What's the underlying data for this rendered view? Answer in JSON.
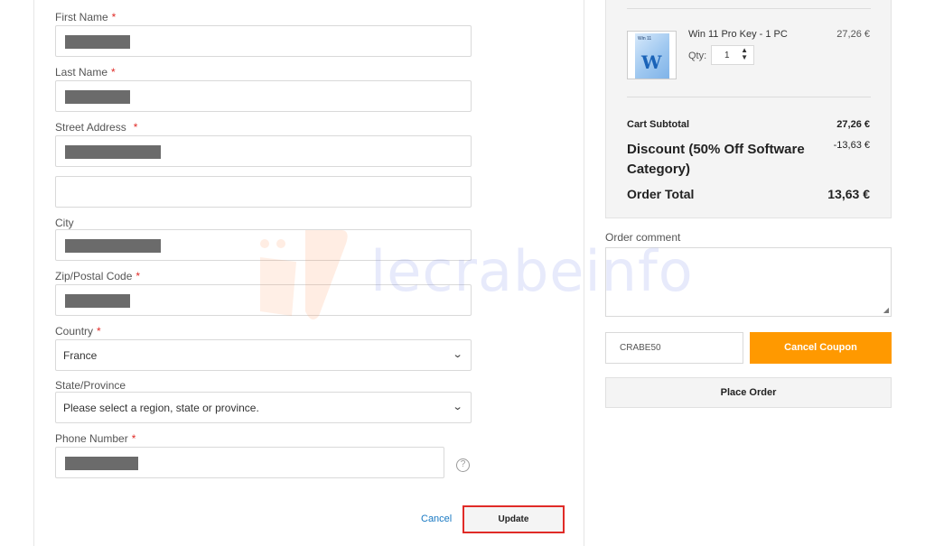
{
  "form": {
    "first_name_label": "First Name",
    "last_name_label": "Last Name",
    "street_label": "Street Address",
    "city_label": "City",
    "zip_label": "Zip/Postal Code",
    "country_label": "Country",
    "country_value": "France",
    "state_label": "State/Province",
    "state_placeholder": "Please select a region, state or province.",
    "phone_label": "Phone Number",
    "required_mark": "*",
    "help_icon": "question-circle-icon",
    "cancel_label": "Cancel",
    "update_label": "Update"
  },
  "summary": {
    "product_name": "Win 11 Pro Key - 1 PC",
    "product_price": "27,26 €",
    "product_thumb_title": "Win 11",
    "product_thumb_letter": "W",
    "qty_label": "Qty:",
    "qty_value": "1",
    "subtotal_label": "Cart Subtotal",
    "subtotal_value": "27,26 €",
    "discount_label": "Discount (50% Off Software Category)",
    "discount_value": "-13,63 €",
    "total_label": "Order Total",
    "total_value": "13,63 €"
  },
  "comment": {
    "label": "Order comment",
    "value": ""
  },
  "coupon": {
    "code": "CRABE50",
    "cancel_label": "Cancel Coupon"
  },
  "place_order_label": "Place Order",
  "watermark_text": "lecrabeinfo",
  "colors": {
    "accent_orange": "#ff9900",
    "required_red": "#e02b27",
    "link_blue": "#1979c3",
    "highlight_red": "#e02b27"
  }
}
